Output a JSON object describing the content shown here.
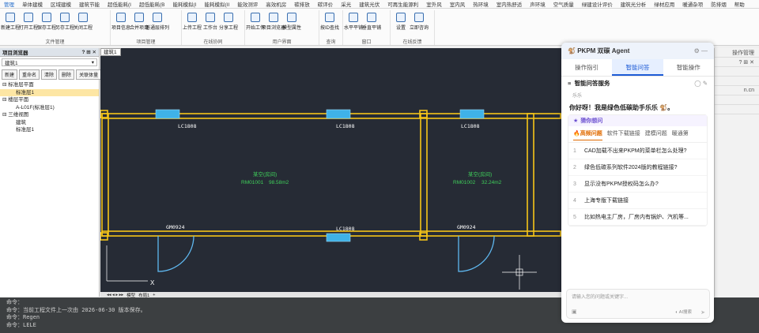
{
  "menu": [
    "管理",
    "单体建模",
    "区域建模",
    "建筑节能",
    "超低能耗(I",
    "超低能耗(B",
    "能耗模拟(I",
    "能耗模拟(II",
    "能效测评",
    "高效机房",
    "碳排放",
    "碳评价",
    "采光",
    "建筑光伏",
    "可再生能源利",
    "室外风",
    "室内风",
    "热环境",
    "室内热舒适",
    "声环境",
    "空气质量",
    "绿建设计评价",
    "建筑光分析",
    "绿材应用",
    "暖通杂项",
    "防排烟",
    "帮助"
  ],
  "ribbon": {
    "g1": {
      "label": "文件管理",
      "btns": [
        "新建工程",
        "打开工程",
        "保存工程",
        "另存工程",
        "关闭工程"
      ]
    },
    "g2": {
      "label": "项目管理",
      "btns": [
        "项目信息",
        "合并项目",
        "普通层排列"
      ]
    },
    "g3": {
      "label": "在线协同",
      "btns": [
        "上传工程",
        "工作台",
        "分享工程"
      ]
    },
    "g4": {
      "label": "用户界面",
      "btns": [
        "开始工作",
        "项目浏览器",
        "模型属性"
      ]
    },
    "g5": {
      "label": "查询",
      "btns": [
        "按ID查找"
      ]
    },
    "g6": {
      "label": "窗口",
      "btns": [
        "水平平铺",
        "垂直平铺"
      ]
    },
    "g7": {
      "label": "在线反馈",
      "btns": [
        "设置",
        "立即咨询"
      ]
    }
  },
  "browser": {
    "title": "项目浏览器",
    "controls": "? ⊞ ✕",
    "select": "建筑1",
    "buttons": [
      "新建",
      "重命名",
      "清除",
      "删除",
      "关联体量"
    ],
    "tree": [
      "标准层平面",
      "标准层1",
      "楼层平面",
      "A-L01F(标准层1)",
      "三维视图",
      "建筑",
      "标准层1"
    ]
  },
  "doc": {
    "tab": "建筑1"
  },
  "plan": {
    "windows": [
      "LC1808",
      "LC1808",
      "LC1808",
      "LC1808"
    ],
    "doors": [
      "GM0924",
      "GM0924"
    ],
    "rooms": [
      {
        "name": "某空(房间)",
        "id": "RM01001",
        "area": "98.58m2"
      },
      {
        "name": "某空(房间)",
        "id": "RM01002",
        "area": "32.24m2"
      }
    ],
    "axis_x": "X"
  },
  "hbar": {
    "tabs": [
      "模型",
      "布局1"
    ],
    "plus": "+"
  },
  "cmdline": [
    "命令：",
    "命令：当前工程文件上一次由 2026-06-30 版本保存。",
    "命令：Regen",
    "命令：LELE"
  ],
  "agent": {
    "title": "PKPM 双碳 Agent",
    "tabs": [
      "操作指引",
      "智能问答",
      "智能操作"
    ],
    "section": "智能问答服务",
    "bot": "乐乐",
    "greeting": "你好呀！我是绿色低碳助手乐乐 🐒。",
    "guess": "猜你想问",
    "qtabs": [
      "🔥高频问题",
      "软件下载链接",
      "建模问题",
      "暖通第"
    ],
    "questions": [
      {
        "n": "1",
        "q": "CAD加载不出来PKPM的菜单栏怎么处理?"
      },
      {
        "n": "2",
        "q": "绿色低碳系列软件2024版的教程链接?"
      },
      {
        "n": "3",
        "q": "显示没有PKPM授权码怎么办?"
      },
      {
        "n": "4",
        "q": "上海专版下载链接"
      },
      {
        "n": "5",
        "q": "比如热电主厂房，厂房内有锅炉、汽机等..."
      }
    ],
    "input_placeholder": "请输入您的问题或关键字...",
    "ai_toggle": "AI搜索"
  },
  "right": {
    "rows": [
      "操作管理",
      "? ⊞ ✕",
      "",
      "",
      "n.cn",
      "",
      "",
      "",
      ""
    ]
  },
  "colors": {
    "accent": "#1d5bd6",
    "wall": "#f5c518",
    "window": "#3fb2e8",
    "canvas": "#262b35"
  }
}
